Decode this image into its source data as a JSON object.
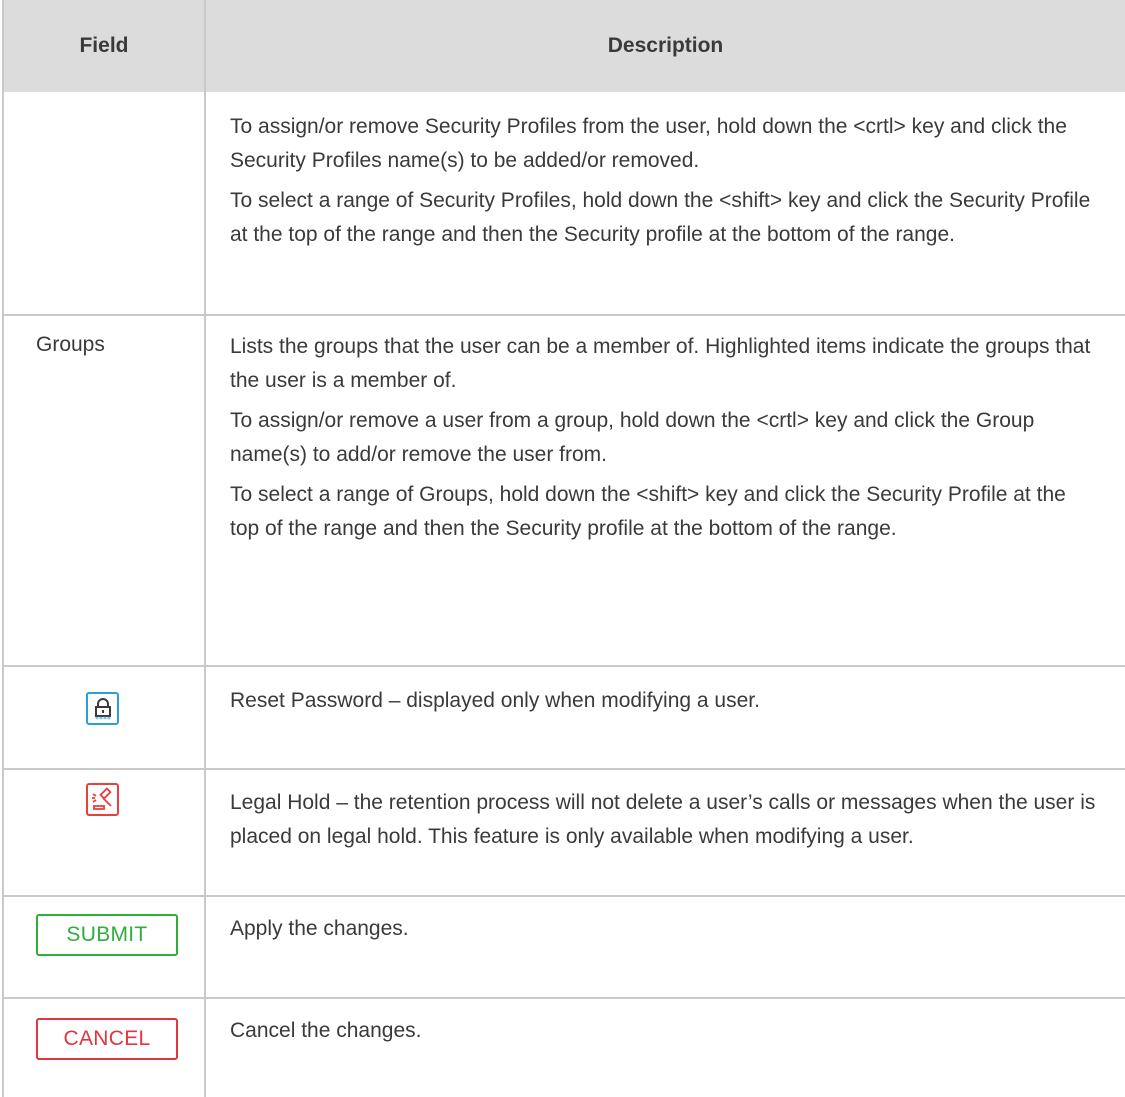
{
  "header": {
    "field": "Field",
    "description": "Description"
  },
  "rows": [
    {
      "field": "",
      "paragraphs": [
        "To assign/or remove Security Profiles from the user, hold down the <crtl> key and click the Security Profiles name(s) to be added/or removed.",
        "To select a range of Security Profiles, hold down the <shift> key and click the Security Profile at the top of the range and then the Security profile at the bottom of the range."
      ]
    },
    {
      "field": "Groups",
      "paragraphs": [
        "Lists the groups that the user can be a member of. Highlighted items indicate the groups that the user is a member of.",
        "To assign/or remove a user from a group, hold down the <crtl> key and click the Group name(s) to add/or remove the user from.",
        "To select a range of Groups, hold down the <shift> key and click the Security Profile at the top of the range and then the Security profile at the bottom of the range."
      ]
    },
    {
      "icon": "reset-password-icon",
      "paragraphs": [
        "Reset Password – displayed only when modifying a user."
      ]
    },
    {
      "icon": "legal-hold-icon",
      "paragraphs": [
        "Legal Hold – the retention process will not delete a user’s calls or messages when the user is placed on legal hold. This feature is only available when modifying a user."
      ]
    },
    {
      "button": "SUBMIT",
      "paragraphs": [
        "Apply the changes."
      ]
    },
    {
      "button": "CANCEL",
      "paragraphs": [
        "Cancel the changes."
      ]
    }
  ],
  "colors": {
    "header_bg": "#dcdcdc",
    "border": "#c9c9c9",
    "reset_password_icon": "#2a9fd8",
    "legal_hold_icon": "#e8413c",
    "submit": "#2fae3b",
    "cancel": "#e3353f"
  }
}
